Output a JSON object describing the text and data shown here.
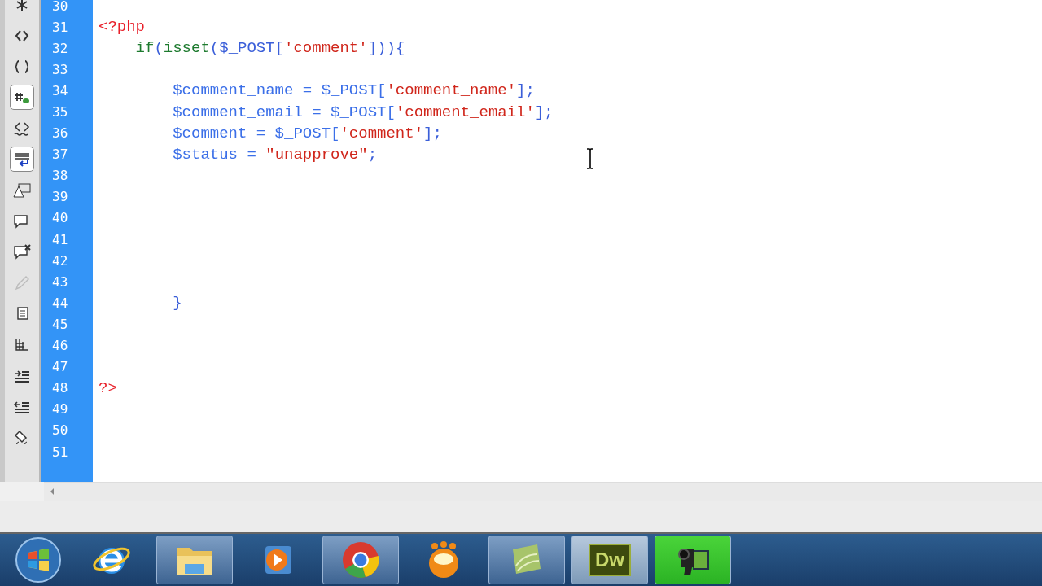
{
  "toolbar": [
    {
      "kind": "asterisk",
      "pressed": false,
      "disabled": false
    },
    {
      "kind": "collapse",
      "pressed": false,
      "disabled": false
    },
    {
      "kind": "braces",
      "pressed": false,
      "disabled": false
    },
    {
      "kind": "hash",
      "pressed": true,
      "disabled": false
    },
    {
      "kind": "tag-wave",
      "pressed": false,
      "disabled": false
    },
    {
      "kind": "wrap",
      "pressed": true,
      "disabled": false
    },
    {
      "kind": "warning",
      "pressed": false,
      "disabled": false
    },
    {
      "kind": "comment",
      "pressed": false,
      "disabled": false
    },
    {
      "kind": "uncomment",
      "pressed": false,
      "disabled": false
    },
    {
      "kind": "pencil",
      "pressed": false,
      "disabled": true
    },
    {
      "kind": "snippet",
      "pressed": false,
      "disabled": false
    },
    {
      "kind": "grid",
      "pressed": false,
      "disabled": false
    },
    {
      "kind": "indent",
      "pressed": false,
      "disabled": false
    },
    {
      "kind": "outdent",
      "pressed": false,
      "disabled": false
    },
    {
      "kind": "format",
      "pressed": false,
      "disabled": false
    }
  ],
  "code_lines": [
    {
      "number": "30"
    },
    {
      "number": "31",
      "kind": "top",
      "tokens": [
        {
          "kind": "tag",
          "text": "<?php"
        }
      ]
    },
    {
      "number": "32",
      "kind": "statement",
      "tokens": [
        {
          "kind": "keyword",
          "text": "if"
        },
        {
          "kind": "punct",
          "text": "("
        },
        {
          "kind": "keyword",
          "text": "isset"
        },
        {
          "kind": "punct",
          "text": "($_POST["
        },
        {
          "kind": "string",
          "text": "'comment'"
        },
        {
          "kind": "punct",
          "text": "])){"
        }
      ]
    },
    {
      "number": "33"
    },
    {
      "number": "34",
      "kind": "body",
      "tokens": [
        {
          "kind": "var",
          "text": "$comment_name = $_POST["
        },
        {
          "kind": "string",
          "text": "'comment_name'"
        },
        {
          "kind": "punct",
          "text": "];"
        }
      ]
    },
    {
      "number": "35",
      "kind": "body",
      "tokens": [
        {
          "kind": "var",
          "text": "$comment_email = $_POST["
        },
        {
          "kind": "string",
          "text": "'comment_email'"
        },
        {
          "kind": "punct",
          "text": "];"
        }
      ]
    },
    {
      "number": "36",
      "kind": "body",
      "tokens": [
        {
          "kind": "var",
          "text": "$comment = $_POST["
        },
        {
          "kind": "string",
          "text": "'comment'"
        },
        {
          "kind": "punct",
          "text": "];"
        }
      ]
    },
    {
      "number": "37",
      "kind": "body",
      "tokens": [
        {
          "kind": "var",
          "text": "$status = "
        },
        {
          "kind": "string",
          "text": "\"unapprove\""
        },
        {
          "kind": "punct",
          "text": ";"
        }
      ]
    },
    {
      "number": "38"
    },
    {
      "number": "39"
    },
    {
      "number": "40"
    },
    {
      "number": "41"
    },
    {
      "number": "42"
    },
    {
      "number": "43"
    },
    {
      "number": "44",
      "kind": "body",
      "tokens": [
        {
          "kind": "punct",
          "text": "}"
        }
      ]
    },
    {
      "number": "45"
    },
    {
      "number": "46"
    },
    {
      "number": "47"
    },
    {
      "number": "48",
      "kind": "top",
      "tokens": [
        {
          "kind": "tag",
          "text": "?>"
        }
      ]
    },
    {
      "number": "49"
    },
    {
      "number": "50"
    },
    {
      "number": "51"
    }
  ],
  "taskbar": [
    {
      "kind": "start",
      "running": false
    },
    {
      "kind": "browser-e",
      "running": false
    },
    {
      "kind": "folder",
      "running": true
    },
    {
      "kind": "player",
      "running": false
    },
    {
      "kind": "chrome",
      "running": true
    },
    {
      "kind": "orange",
      "running": false
    },
    {
      "kind": "green-app",
      "running": true
    },
    {
      "kind": "dw",
      "running": true,
      "label": "Dw"
    },
    {
      "kind": "camera",
      "running": true
    }
  ]
}
